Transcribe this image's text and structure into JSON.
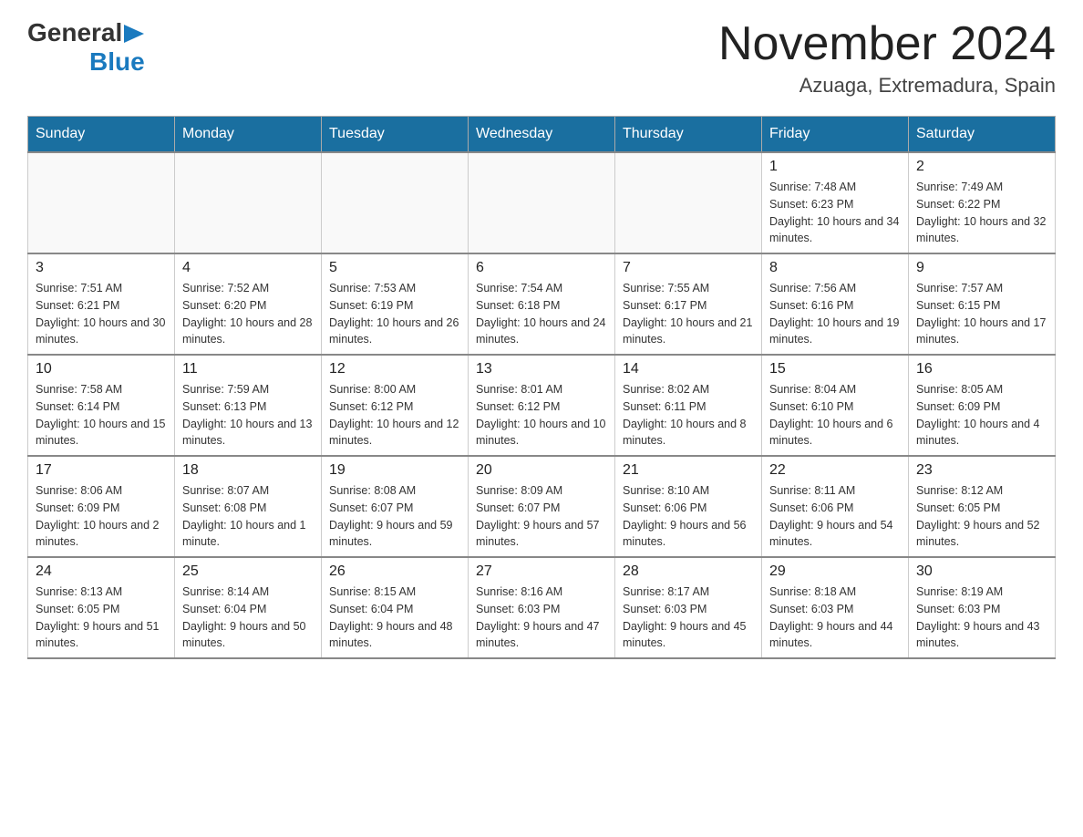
{
  "header": {
    "logo_general": "General",
    "logo_blue": "Blue",
    "month_title": "November 2024",
    "location": "Azuaga, Extremadura, Spain"
  },
  "weekdays": [
    "Sunday",
    "Monday",
    "Tuesday",
    "Wednesday",
    "Thursday",
    "Friday",
    "Saturday"
  ],
  "weeks": [
    [
      {
        "day": "",
        "sunrise": "",
        "sunset": "",
        "daylight": ""
      },
      {
        "day": "",
        "sunrise": "",
        "sunset": "",
        "daylight": ""
      },
      {
        "day": "",
        "sunrise": "",
        "sunset": "",
        "daylight": ""
      },
      {
        "day": "",
        "sunrise": "",
        "sunset": "",
        "daylight": ""
      },
      {
        "day": "",
        "sunrise": "",
        "sunset": "",
        "daylight": ""
      },
      {
        "day": "1",
        "sunrise": "Sunrise: 7:48 AM",
        "sunset": "Sunset: 6:23 PM",
        "daylight": "Daylight: 10 hours and 34 minutes."
      },
      {
        "day": "2",
        "sunrise": "Sunrise: 7:49 AM",
        "sunset": "Sunset: 6:22 PM",
        "daylight": "Daylight: 10 hours and 32 minutes."
      }
    ],
    [
      {
        "day": "3",
        "sunrise": "Sunrise: 7:51 AM",
        "sunset": "Sunset: 6:21 PM",
        "daylight": "Daylight: 10 hours and 30 minutes."
      },
      {
        "day": "4",
        "sunrise": "Sunrise: 7:52 AM",
        "sunset": "Sunset: 6:20 PM",
        "daylight": "Daylight: 10 hours and 28 minutes."
      },
      {
        "day": "5",
        "sunrise": "Sunrise: 7:53 AM",
        "sunset": "Sunset: 6:19 PM",
        "daylight": "Daylight: 10 hours and 26 minutes."
      },
      {
        "day": "6",
        "sunrise": "Sunrise: 7:54 AM",
        "sunset": "Sunset: 6:18 PM",
        "daylight": "Daylight: 10 hours and 24 minutes."
      },
      {
        "day": "7",
        "sunrise": "Sunrise: 7:55 AM",
        "sunset": "Sunset: 6:17 PM",
        "daylight": "Daylight: 10 hours and 21 minutes."
      },
      {
        "day": "8",
        "sunrise": "Sunrise: 7:56 AM",
        "sunset": "Sunset: 6:16 PM",
        "daylight": "Daylight: 10 hours and 19 minutes."
      },
      {
        "day": "9",
        "sunrise": "Sunrise: 7:57 AM",
        "sunset": "Sunset: 6:15 PM",
        "daylight": "Daylight: 10 hours and 17 minutes."
      }
    ],
    [
      {
        "day": "10",
        "sunrise": "Sunrise: 7:58 AM",
        "sunset": "Sunset: 6:14 PM",
        "daylight": "Daylight: 10 hours and 15 minutes."
      },
      {
        "day": "11",
        "sunrise": "Sunrise: 7:59 AM",
        "sunset": "Sunset: 6:13 PM",
        "daylight": "Daylight: 10 hours and 13 minutes."
      },
      {
        "day": "12",
        "sunrise": "Sunrise: 8:00 AM",
        "sunset": "Sunset: 6:12 PM",
        "daylight": "Daylight: 10 hours and 12 minutes."
      },
      {
        "day": "13",
        "sunrise": "Sunrise: 8:01 AM",
        "sunset": "Sunset: 6:12 PM",
        "daylight": "Daylight: 10 hours and 10 minutes."
      },
      {
        "day": "14",
        "sunrise": "Sunrise: 8:02 AM",
        "sunset": "Sunset: 6:11 PM",
        "daylight": "Daylight: 10 hours and 8 minutes."
      },
      {
        "day": "15",
        "sunrise": "Sunrise: 8:04 AM",
        "sunset": "Sunset: 6:10 PM",
        "daylight": "Daylight: 10 hours and 6 minutes."
      },
      {
        "day": "16",
        "sunrise": "Sunrise: 8:05 AM",
        "sunset": "Sunset: 6:09 PM",
        "daylight": "Daylight: 10 hours and 4 minutes."
      }
    ],
    [
      {
        "day": "17",
        "sunrise": "Sunrise: 8:06 AM",
        "sunset": "Sunset: 6:09 PM",
        "daylight": "Daylight: 10 hours and 2 minutes."
      },
      {
        "day": "18",
        "sunrise": "Sunrise: 8:07 AM",
        "sunset": "Sunset: 6:08 PM",
        "daylight": "Daylight: 10 hours and 1 minute."
      },
      {
        "day": "19",
        "sunrise": "Sunrise: 8:08 AM",
        "sunset": "Sunset: 6:07 PM",
        "daylight": "Daylight: 9 hours and 59 minutes."
      },
      {
        "day": "20",
        "sunrise": "Sunrise: 8:09 AM",
        "sunset": "Sunset: 6:07 PM",
        "daylight": "Daylight: 9 hours and 57 minutes."
      },
      {
        "day": "21",
        "sunrise": "Sunrise: 8:10 AM",
        "sunset": "Sunset: 6:06 PM",
        "daylight": "Daylight: 9 hours and 56 minutes."
      },
      {
        "day": "22",
        "sunrise": "Sunrise: 8:11 AM",
        "sunset": "Sunset: 6:06 PM",
        "daylight": "Daylight: 9 hours and 54 minutes."
      },
      {
        "day": "23",
        "sunrise": "Sunrise: 8:12 AM",
        "sunset": "Sunset: 6:05 PM",
        "daylight": "Daylight: 9 hours and 52 minutes."
      }
    ],
    [
      {
        "day": "24",
        "sunrise": "Sunrise: 8:13 AM",
        "sunset": "Sunset: 6:05 PM",
        "daylight": "Daylight: 9 hours and 51 minutes."
      },
      {
        "day": "25",
        "sunrise": "Sunrise: 8:14 AM",
        "sunset": "Sunset: 6:04 PM",
        "daylight": "Daylight: 9 hours and 50 minutes."
      },
      {
        "day": "26",
        "sunrise": "Sunrise: 8:15 AM",
        "sunset": "Sunset: 6:04 PM",
        "daylight": "Daylight: 9 hours and 48 minutes."
      },
      {
        "day": "27",
        "sunrise": "Sunrise: 8:16 AM",
        "sunset": "Sunset: 6:03 PM",
        "daylight": "Daylight: 9 hours and 47 minutes."
      },
      {
        "day": "28",
        "sunrise": "Sunrise: 8:17 AM",
        "sunset": "Sunset: 6:03 PM",
        "daylight": "Daylight: 9 hours and 45 minutes."
      },
      {
        "day": "29",
        "sunrise": "Sunrise: 8:18 AM",
        "sunset": "Sunset: 6:03 PM",
        "daylight": "Daylight: 9 hours and 44 minutes."
      },
      {
        "day": "30",
        "sunrise": "Sunrise: 8:19 AM",
        "sunset": "Sunset: 6:03 PM",
        "daylight": "Daylight: 9 hours and 43 minutes."
      }
    ]
  ]
}
